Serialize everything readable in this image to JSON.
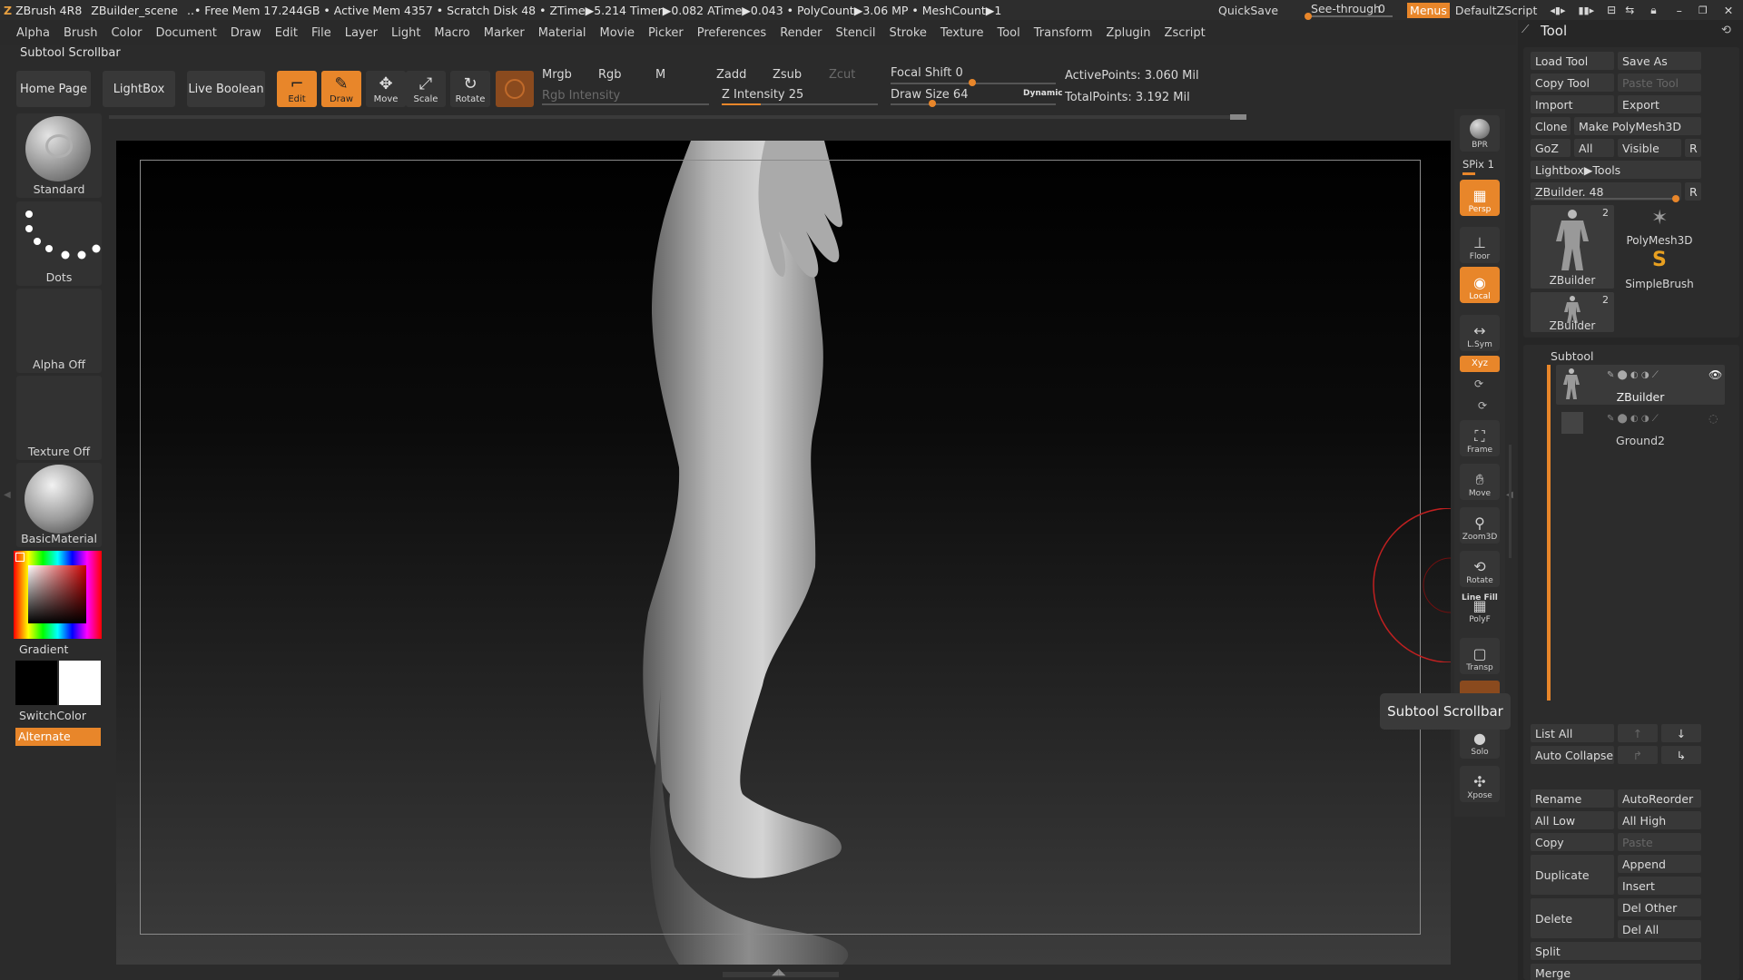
{
  "titlebar": {
    "app": "ZBrush 4R8",
    "scene": "ZBuilder_scene",
    "stats": "..• Free Mem 17.244GB • Active Mem 4357 • Scratch Disk 48 • ZTime▶5.214 Timer▶0.082 ATime▶0.043 • PolyCount▶3.06 MP • MeshCount▶1",
    "quicksave": "QuickSave",
    "see_through_label": "See-through",
    "see_through_value": "0",
    "menus": "Menus",
    "default_script": "DefaultZScript"
  },
  "menubar": [
    "Alpha",
    "Brush",
    "Color",
    "Document",
    "Draw",
    "Edit",
    "File",
    "Layer",
    "Light",
    "Macro",
    "Marker",
    "Material",
    "Movie",
    "Picker",
    "Preferences",
    "Render",
    "Stencil",
    "Stroke",
    "Texture",
    "Tool",
    "Transform",
    "Zplugin",
    "Zscript"
  ],
  "subtool_scrollbar_label": "Subtool Scrollbar",
  "toolbar": {
    "home": "Home Page",
    "lightbox": "LightBox",
    "live_boolean": "Live Boolean",
    "edit": "Edit",
    "draw": "Draw",
    "move": "Move",
    "scale": "Scale",
    "rotate": "Rotate",
    "mrgb": "Mrgb",
    "rgb": "Rgb",
    "m": "M",
    "rgb_intensity": "Rgb Intensity",
    "zadd": "Zadd",
    "zsub": "Zsub",
    "zcut": "Zcut",
    "z_intensity_label": "Z Intensity",
    "z_intensity_value": "25",
    "z_intensity_fraction": 0.25,
    "focal_shift_label": "Focal Shift",
    "focal_shift_value": "0",
    "draw_size_label": "Draw Size",
    "draw_size_value": "64",
    "dynamic": "Dynamic",
    "active_points": "ActivePoints: 3.060 Mil",
    "total_points": "TotalPoints: 3.192 Mil"
  },
  "shelf": {
    "brush": "Standard",
    "stroke": "Dots",
    "alpha": "Alpha Off",
    "texture": "Texture Off",
    "material": "BasicMaterial",
    "gradient": "Gradient",
    "switch_color": "SwitchColor",
    "alternate": "Alternate"
  },
  "dock": {
    "bpr": "BPR",
    "spix": "SPix 1",
    "persp": "Persp",
    "floor": "Floor",
    "local": "Local",
    "lsym": "L.Sym",
    "xyz": "Xyz",
    "frame": "Frame",
    "move": "Move",
    "zoom3d": "Zoom3D",
    "rotate": "Rotate",
    "linefill": "Line Fill",
    "polyf": "PolyF",
    "transp": "Transp",
    "solo": "Solo",
    "xpose": "Xpose"
  },
  "toolpanel": {
    "title": "Tool",
    "load_tool": "Load Tool",
    "save_as": "Save As",
    "copy_tool": "Copy Tool",
    "paste_tool": "Paste Tool",
    "import": "Import",
    "export": "Export",
    "clone": "Clone",
    "make_polymesh": "Make PolyMesh3D",
    "goz": "GoZ",
    "all": "All",
    "visible": "Visible",
    "r": "R",
    "lightbox_tools": "Lightbox▶Tools",
    "zbuilder_slider": "ZBuilder. 48",
    "thumb_zbuilder_1": "ZBuilder",
    "thumb_zbuilder_1_count": "2",
    "thumb_polymesh": "PolyMesh3D",
    "thumb_simplebrush": "SimpleBrush",
    "thumb_zbuilder_2": "ZBuilder",
    "thumb_zbuilder_2_count": "2",
    "subtool": "Subtool",
    "subtool_1": "ZBuilder",
    "subtool_2": "Ground2",
    "list_all": "List All",
    "auto_collapse": "Auto Collapse",
    "rename": "Rename",
    "auto_reorder": "AutoReorder",
    "all_low": "All Low",
    "all_high": "All High",
    "copy": "Copy",
    "paste": "Paste",
    "duplicate": "Duplicate",
    "append": "Append",
    "insert": "Insert",
    "delete": "Delete",
    "del_other": "Del Other",
    "del_all": "Del All",
    "split": "Split",
    "merge": "Merge"
  },
  "tooltip": "Subtool Scrollbar",
  "colors": {
    "accent": "#e8862a",
    "panel": "#262626",
    "button": "#383838"
  }
}
